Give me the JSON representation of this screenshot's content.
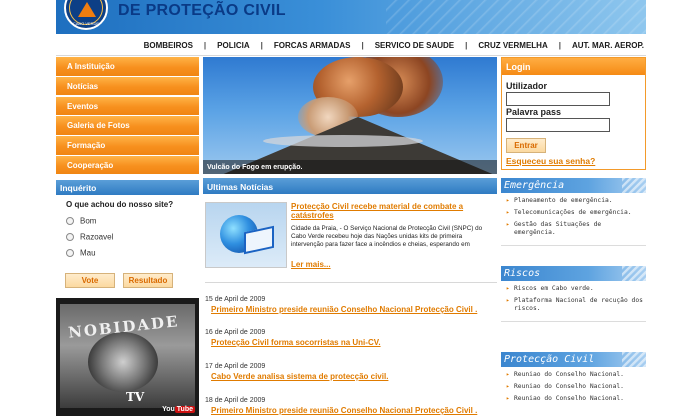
{
  "header": {
    "title": "DE PROTEÇÃO CIVIL",
    "logo_caption": "CABO VERDE"
  },
  "topnav": [
    "BOMBEIROS",
    "POLICIA",
    "FORCAS ARMADAS",
    "SERVICO DE SAUDE",
    "CRUZ VERMELHA",
    "AUT. MAR. AEROP."
  ],
  "left_menu": [
    "A Instituição",
    "Notícias",
    "Eventos",
    "Galeria de Fotos",
    "Formação",
    "Cooperação"
  ],
  "poll": {
    "heading": "Inquérito",
    "question": "O que achou do nosso site?",
    "options": [
      "Bom",
      "Razoavel",
      "Mau"
    ],
    "vote_label": "Vote",
    "results_label": "Resultado"
  },
  "video": {
    "title": "NOBIDADE",
    "subtitle": "TV",
    "brand_you": "You",
    "brand_tube": "Tube"
  },
  "hero": {
    "caption": "Vulcão do Fogo em erupção."
  },
  "news": {
    "heading": "Ultimas Notícias",
    "feature": {
      "title": "Protecção Civil recebe material de combate a catástrofes",
      "body": "Cidade da Praia, - O Serviço Nacional de Protecção Civil (SNPC) do Cabo Verde recebeu hoje das Nações unidas kits de primeira intervenção para fazer face a incêndios e cheias, esperando em",
      "more": "Ler mais..."
    },
    "items": [
      {
        "date": "15 de April de 2009",
        "title": "Primeiro Ministro preside reunião Conselho Nacional  Protecção Civil ."
      },
      {
        "date": "16 de April de 2009",
        "title": "Protecção Civil forma socorristas na Uni-CV."
      },
      {
        "date": "17 de April de 2009",
        "title": "Cabo Verde analisa sistema de protecção civil."
      },
      {
        "date": "18 de April de 2009",
        "title": "Primeiro Ministro preside reunião Conselho Nacional  Protecção Civil ."
      }
    ]
  },
  "login": {
    "heading": "Login",
    "user_label": "Utilizador",
    "pass_label": "Palavra pass",
    "enter_label": "Entrar",
    "forgot_label": "Esqueceu sua senha?"
  },
  "right_boxes": [
    {
      "heading": "Emergência",
      "items": [
        "Planeamento de emergência.",
        "Telecomunicações de emergência.",
        "Gestão das Situações de emergência."
      ]
    },
    {
      "heading": "Riscos",
      "items": [
        "Riscos em Cabo verde.",
        "Plataforma Nacional de recução dos riscos."
      ]
    },
    {
      "heading": "Protecção Civil",
      "items": [
        "Reuniao do Conselho Nacional.",
        "Reuniao do Conselho Nacional.",
        "Reuniao do Conselho Nacional."
      ]
    }
  ],
  "colors": {
    "orange": "#f7901e",
    "blue": "#2f7bc2",
    "link": "#e07b00"
  }
}
